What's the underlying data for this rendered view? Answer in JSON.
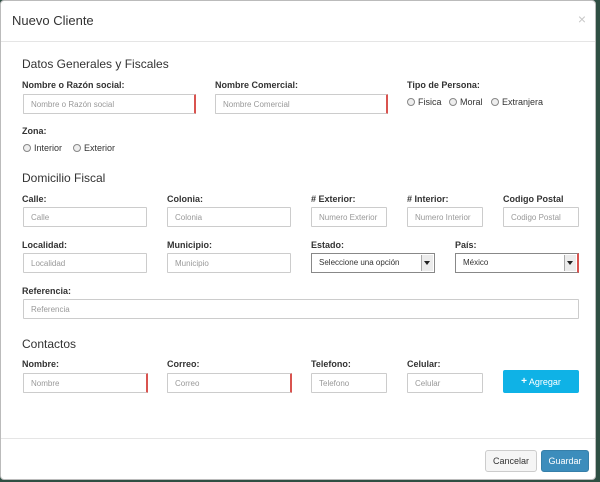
{
  "modal": {
    "title": "Nuevo Cliente",
    "close": "×"
  },
  "general": {
    "section_title": "Datos Generales y Fiscales",
    "razon_label": "Nombre o Razón social:",
    "razon_placeholder": "Nombre o Razón social",
    "comercial_label": "Nombre Comercial:",
    "comercial_placeholder": "Nombre Comercial",
    "tipo_label": "Tipo de Persona:",
    "tipo_options": [
      "Fisica",
      "Moral",
      "Extranjera"
    ],
    "zona_label": "Zona:",
    "zona_options": [
      "Interior",
      "Exterior"
    ]
  },
  "domicilio": {
    "section_title": "Domicilio Fiscal",
    "calle_label": "Calle:",
    "calle_placeholder": "Calle",
    "colonia_label": "Colonia:",
    "colonia_placeholder": "Colonia",
    "exterior_label": "# Exterior:",
    "exterior_placeholder": "Numero Exterior",
    "interior_label": "# Interior:",
    "interior_placeholder": "Numero Interior",
    "cp_label": "Codigo Postal",
    "cp_placeholder": "Codigo Postal",
    "localidad_label": "Localidad:",
    "localidad_placeholder": "Localidad",
    "municipio_label": "Municipio:",
    "municipio_placeholder": "Municipio",
    "estado_label": "Estado:",
    "estado_value": "Seleccione una opción",
    "pais_label": "País:",
    "pais_value": "México",
    "referencia_label": "Referencia:",
    "referencia_placeholder": "Referencia"
  },
  "contactos": {
    "section_title": "Contactos",
    "nombre_label": "Nombre:",
    "nombre_placeholder": "Nombre",
    "correo_label": "Correo:",
    "correo_placeholder": "Correo",
    "telefono_label": "Telefono:",
    "telefono_placeholder": "Telefono",
    "celular_label": "Celular:",
    "celular_placeholder": "Celular",
    "agregar_label": "Agregar"
  },
  "footer": {
    "cancel_label": "Cancelar",
    "save_label": "Guardar"
  },
  "colors": {
    "primary": "#3c8dbc",
    "accent": "#0fb2e6",
    "required": "#d9534f"
  }
}
